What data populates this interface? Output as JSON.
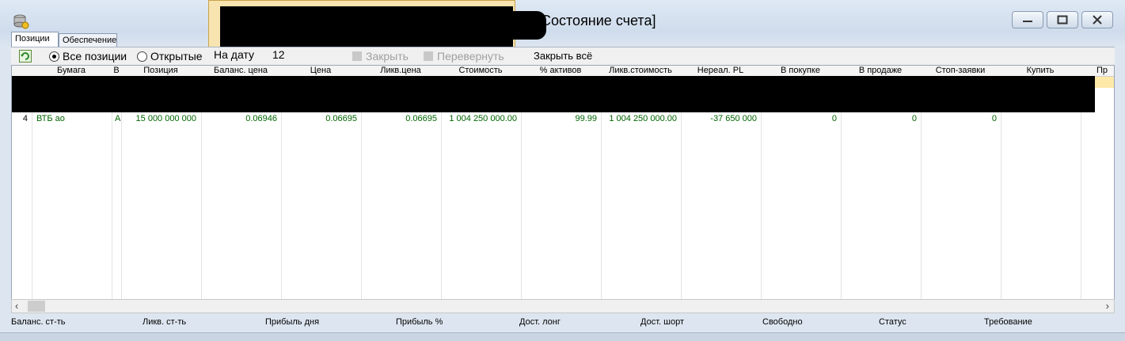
{
  "window": {
    "title": "[Состояние счета]",
    "buttons": [
      "minimize",
      "maximize",
      "close"
    ]
  },
  "tabs": [
    {
      "label": "Позиции",
      "active": true
    },
    {
      "label": "Обеспечение",
      "active": false
    }
  ],
  "toolbar": {
    "refresh_icon": "refresh-icon",
    "radio_all": "Все позиции",
    "radio_open": "Открытые",
    "date_label": "На дату",
    "date_value": "12",
    "close_label": "Закрыть",
    "reverse_label": "Перевернуть",
    "close_all_label": "Закрыть всё"
  },
  "columns": [
    "Бумага",
    "В",
    "Позиция",
    "Баланс. цена",
    "Цена",
    "Ликв.цена",
    "Стоимость",
    "% активов",
    "Ликв.стоимость",
    "Нереал. PL",
    "В покупке",
    "В продаже",
    "Стоп-заявки",
    "Купить",
    "Пр"
  ],
  "rows": [
    {
      "num": "4",
      "cells": [
        "ВТБ ао",
        "А",
        "15 000 000 000",
        "0.06946",
        "0.06695",
        "0.06695",
        "1 004 250 000.00",
        "99.99",
        "1 004 250 000.00",
        "-37 650 000",
        "0",
        "0",
        "0",
        "",
        ""
      ]
    }
  ],
  "footer": [
    "Баланс. ст-ть",
    "Ликв. ст-ть",
    "Прибыль дня",
    "Прибыль %",
    "Дост. лонг",
    "Дост. шорт",
    "Свободно",
    "Статус",
    "Требование"
  ],
  "colors": {
    "cell_text": "#006400",
    "redaction": "#000000",
    "highlight": "#ffe9a8"
  }
}
